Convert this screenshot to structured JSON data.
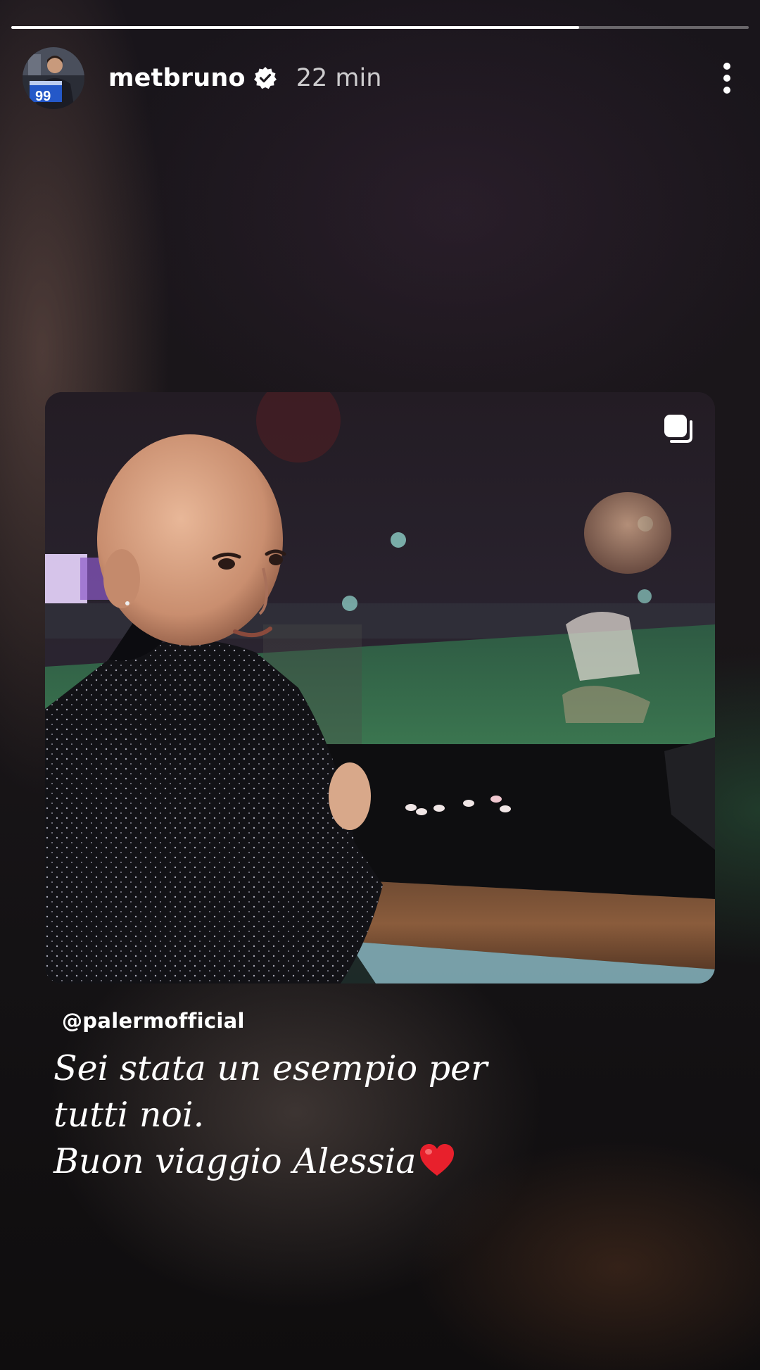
{
  "story": {
    "progress_fraction": 0.77
  },
  "header": {
    "username": "metbruno",
    "verified_icon": "verified-badge-icon",
    "time_ago": "22 min",
    "more_icon": "more-vertical-icon"
  },
  "post": {
    "carousel_icon": "carousel-icon"
  },
  "caption": {
    "mention": "@palermofficial",
    "line1": "Sei stata un esempio per",
    "line2": "tutti noi.",
    "line3": "Buon viaggio Alessia",
    "emoji_icon": "red-heart-icon"
  },
  "colors": {
    "accent": "#ffffff",
    "verified_blue": "#ffffff",
    "heart_red": "#e8202c"
  }
}
